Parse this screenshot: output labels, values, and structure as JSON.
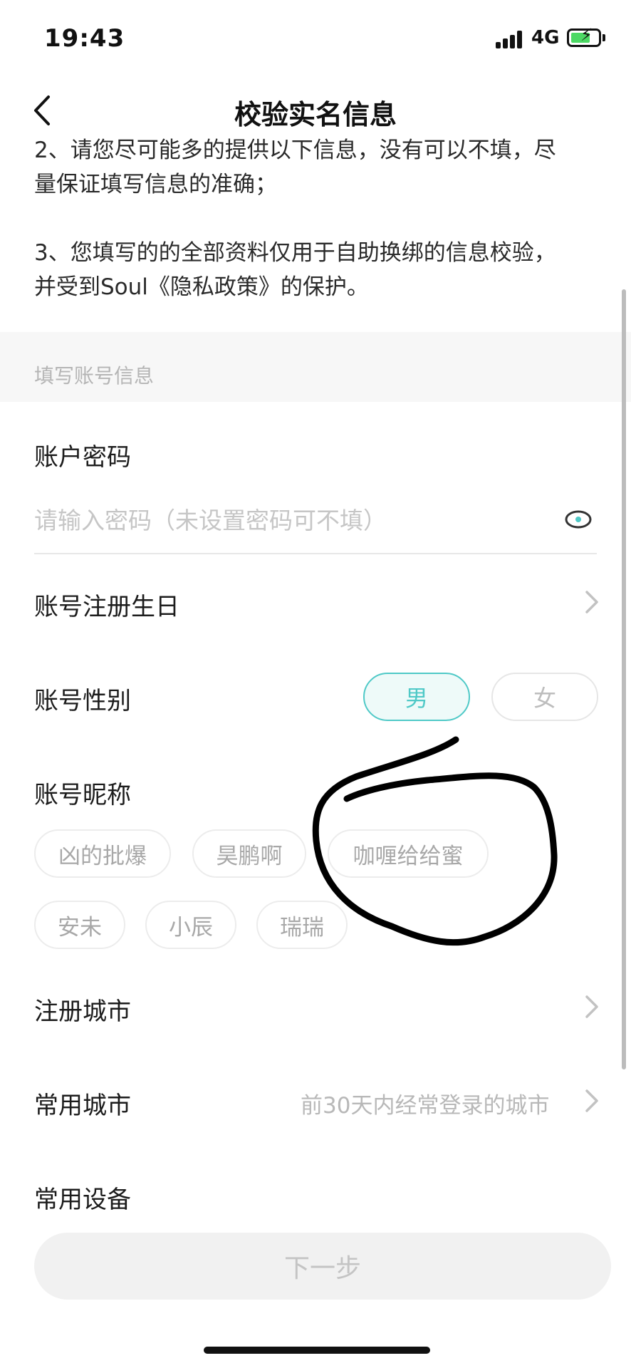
{
  "status_bar": {
    "time": "19:43",
    "network": "4G"
  },
  "header": {
    "title": "校验实名信息"
  },
  "intro": {
    "line_2_cut": "2、请您尽可能多的提供以下信息，没有可以不填，尽",
    "line_2b": "量保证填写信息的准确；",
    "line_3a": "3、您填写的的全部资料仅用于自助换绑的信息校验，",
    "line_3b": "并受到Soul《隐私政策》的保护。"
  },
  "section": {
    "title": "填写账号信息"
  },
  "password": {
    "label": "账户密码",
    "placeholder": "请输入密码（未设置密码可不填）"
  },
  "birthday": {
    "label": "账号注册生日"
  },
  "gender": {
    "label": "账号性别",
    "male": "男",
    "female": "女",
    "selected": "男"
  },
  "nickname": {
    "label": "账号昵称",
    "options": [
      "凶的批爆",
      "昊鹏啊",
      "咖喱给给蜜",
      "安未",
      "小辰",
      "瑞瑞"
    ]
  },
  "register_city": {
    "label": "注册城市"
  },
  "frequent_city": {
    "label": "常用城市",
    "hint": "前30天内经常登录的城市"
  },
  "frequent_device": {
    "label": "常用设备"
  },
  "next_button": {
    "label": "下一步"
  },
  "colors": {
    "accent": "#4fc9c7",
    "battery": "#4cd964",
    "annotation": "#000000"
  },
  "icons": [
    "back-arrow-icon",
    "eye-icon",
    "chevron-right-icon",
    "signal-icon",
    "battery-icon"
  ]
}
